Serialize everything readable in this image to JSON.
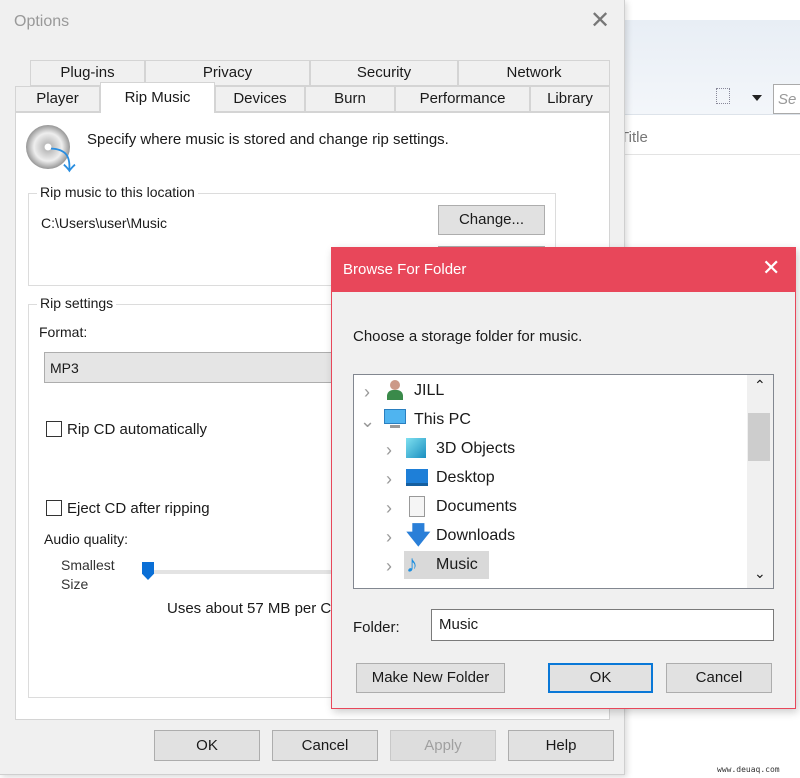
{
  "background": {
    "column_title": "Title",
    "search_placeholder": "Se"
  },
  "options": {
    "title": "Options",
    "tabs_row1": [
      "Plug-ins",
      "Privacy",
      "Security",
      "Network"
    ],
    "tabs_row2": [
      "Player",
      "Rip Music",
      "Devices",
      "Burn",
      "Performance",
      "Library"
    ],
    "selected_tab": "Rip Music",
    "description": "Specify where music is stored and change rip settings.",
    "location_group": "Rip music to this location",
    "location_path": "C:\\Users\\user\\Music",
    "change_button": "Change...",
    "settings_group": "Rip settings",
    "format_label": "Format:",
    "format_value": "MP3",
    "rip_cd_auto": {
      "label": "Rip CD automatically",
      "checked": false
    },
    "eject_cd": {
      "label": "Eject CD after ripping",
      "checked": false
    },
    "audio_quality_label": "Audio quality:",
    "smallest_size": "Smallest",
    "smallest_size2": "Size",
    "audio_quality_level": 0,
    "usage_text": "Uses about 57 MB per C",
    "buttons": {
      "ok": "OK",
      "cancel": "Cancel",
      "apply": "Apply",
      "help": "Help"
    }
  },
  "browse": {
    "title": "Browse For Folder",
    "accent": "#e8475a",
    "prompt": "Choose a storage folder for music.",
    "tree": [
      {
        "label": "JILL",
        "icon": "user-icon",
        "expanded": false,
        "level": 0
      },
      {
        "label": "This PC",
        "icon": "computer-icon",
        "expanded": true,
        "level": 0
      },
      {
        "label": "3D Objects",
        "icon": "cube-icon",
        "expanded": false,
        "level": 1
      },
      {
        "label": "Desktop",
        "icon": "desktop-icon",
        "expanded": false,
        "level": 1
      },
      {
        "label": "Documents",
        "icon": "document-icon",
        "expanded": false,
        "level": 1
      },
      {
        "label": "Downloads",
        "icon": "download-icon",
        "expanded": false,
        "level": 1
      },
      {
        "label": "Music",
        "icon": "music-icon",
        "expanded": false,
        "level": 1,
        "selected": true
      }
    ],
    "folder_label": "Folder:",
    "folder_value": "Music",
    "buttons": {
      "new_folder": "Make New Folder",
      "ok": "OK",
      "cancel": "Cancel"
    }
  },
  "watermark": "www.deuaq.com"
}
